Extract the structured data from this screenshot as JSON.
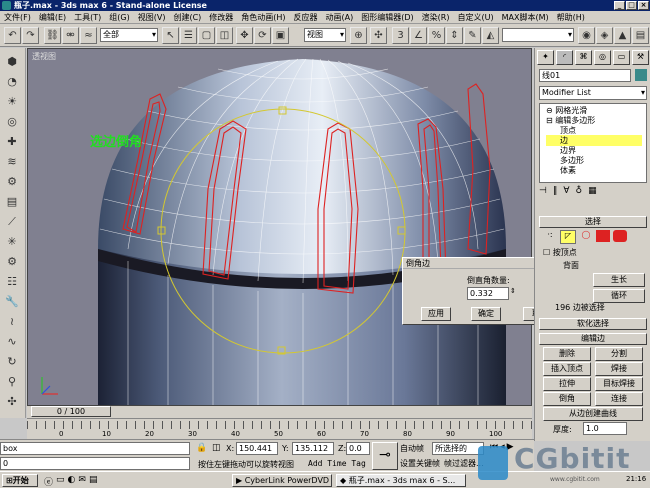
{
  "window": {
    "title": "瓶子.max - 3ds max 6 - Stand-alone License"
  },
  "menu": [
    "文件(F)",
    "编辑(E)",
    "工具(T)",
    "组(G)",
    "视图(V)",
    "创建(C)",
    "修改器",
    "角色动画(H)",
    "反应器",
    "动画(A)",
    "图形编辑器(D)",
    "渲染(R)",
    "自定义(U)",
    "MAX脚本(M)",
    "帮助(H)"
  ],
  "toolbar": {
    "selection_filter": "全部",
    "coord_system": "视图"
  },
  "viewport": {
    "label": "透视图",
    "annotation": "选边倒角"
  },
  "dialog": {
    "title": "倒角边",
    "amount_label": "倒直角数量:",
    "amount_value": "0.332",
    "apply": "应用",
    "ok": "确定",
    "cancel": "取消"
  },
  "command_panel": {
    "object_name": "线01",
    "modifier_list": "Modifier List",
    "stack": [
      "网格光滑",
      "编辑多边形",
      "顶点",
      "边",
      "边界",
      "多边形",
      "体素"
    ],
    "selected_stack_item": "边",
    "selection_header": "选择",
    "by_vertex": "按顶点",
    "face_fragment": "背面",
    "grow": "生长",
    "loop": "循环",
    "selected_count": "196 边被选择",
    "soft_selection_header": "软化选择",
    "edit_edges_header": "编辑边",
    "buttons": [
      "删除",
      "分割",
      "插入顶点",
      "焊接",
      "拉伸",
      "目标焊接",
      "倒角",
      "连接"
    ],
    "create_shape": "从边创建曲线",
    "thickness_label": "厚度:",
    "thickness_value": "1.0"
  },
  "timeline": {
    "frame": "0 / 100"
  },
  "ruler_ticks": [
    "0",
    "10",
    "20",
    "30",
    "40",
    "50",
    "60",
    "70",
    "80",
    "90",
    "100"
  ],
  "status": {
    "field1": "box",
    "field2": "0",
    "x_label": "X:",
    "x": "150.441",
    "y_label": "Y:",
    "y": "135.112",
    "z_label": "Z:",
    "z": "0.0",
    "auto_key": "自动帧",
    "set_key": "设置关键帧",
    "selected_dropdown": "所选择的",
    "key_filters": "帧过滤器...",
    "prompt": "按住左键拖动可以旋转视图",
    "add_time_tag": "Add Time Tag"
  },
  "taskbar": {
    "start": "开始",
    "task1": "CyberLink PowerDVD",
    "task2": "瓶子.max - 3ds max 6 - S...",
    "clock": "21:16"
  },
  "logo": {
    "text": "CGbitit",
    "url": "www.cgbitit.com"
  },
  "colors": {
    "title_bg": "#0a246a",
    "highlight": "#ffff66",
    "edge_red": "#dd2222",
    "accent_green": "#22dd22"
  }
}
